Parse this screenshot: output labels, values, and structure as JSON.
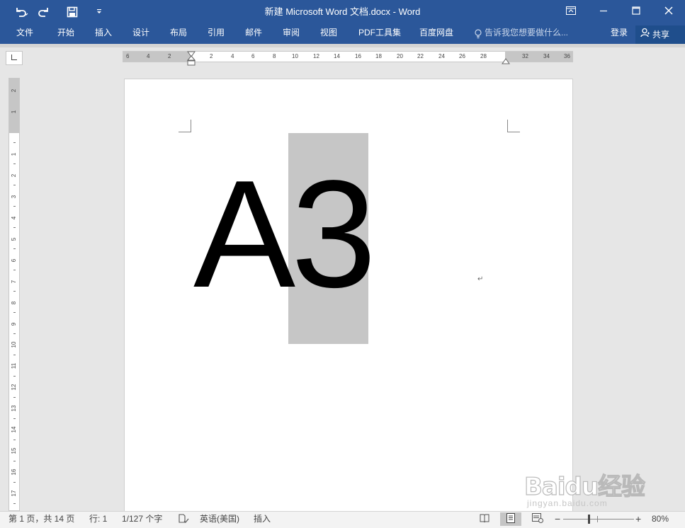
{
  "window": {
    "title": "新建 Microsoft Word 文档.docx - Word"
  },
  "quick_access": {
    "undo_icon": "undo-icon",
    "redo_icon": "redo-icon",
    "save_icon": "save-icon",
    "customize_icon": "customize-qat-icon"
  },
  "ribbon": {
    "tabs": [
      "文件",
      "开始",
      "插入",
      "设计",
      "布局",
      "引用",
      "邮件",
      "审阅",
      "视图",
      "PDF工具集",
      "百度网盘"
    ],
    "tell_me_placeholder": "告诉我您想要做什么...",
    "login_label": "登录",
    "share_label": "共享"
  },
  "ruler": {
    "horizontal_labels": [
      "6",
      "4",
      "2",
      "2",
      "4",
      "6",
      "8",
      "10",
      "12",
      "14",
      "16",
      "18",
      "20",
      "22",
      "24",
      "26",
      "28",
      "32",
      "34",
      "36"
    ],
    "vertical_labels": [
      "2",
      "1",
      "1",
      "2",
      "3",
      "4",
      "5",
      "6",
      "7",
      "8",
      "9",
      "10",
      "11",
      "12",
      "13",
      "14",
      "15",
      "16",
      "17"
    ]
  },
  "document": {
    "text_plain": "A",
    "text_selected": "3",
    "paragraph_mark": "↵"
  },
  "status": {
    "page_info": "第 1 页，共 14 页",
    "line_info": "行: 1",
    "word_count": "1/127 个字",
    "language": "英语(美国)",
    "insert_mode": "插入",
    "zoom_label": "80%",
    "zoom_minus": "−",
    "zoom_plus": "+"
  },
  "watermark": {
    "logo_text": "Baidu经验",
    "url": "jingyan.baidu.com"
  },
  "colors": {
    "title_bar": "#2b579a",
    "selection": "#c6c6c6"
  }
}
